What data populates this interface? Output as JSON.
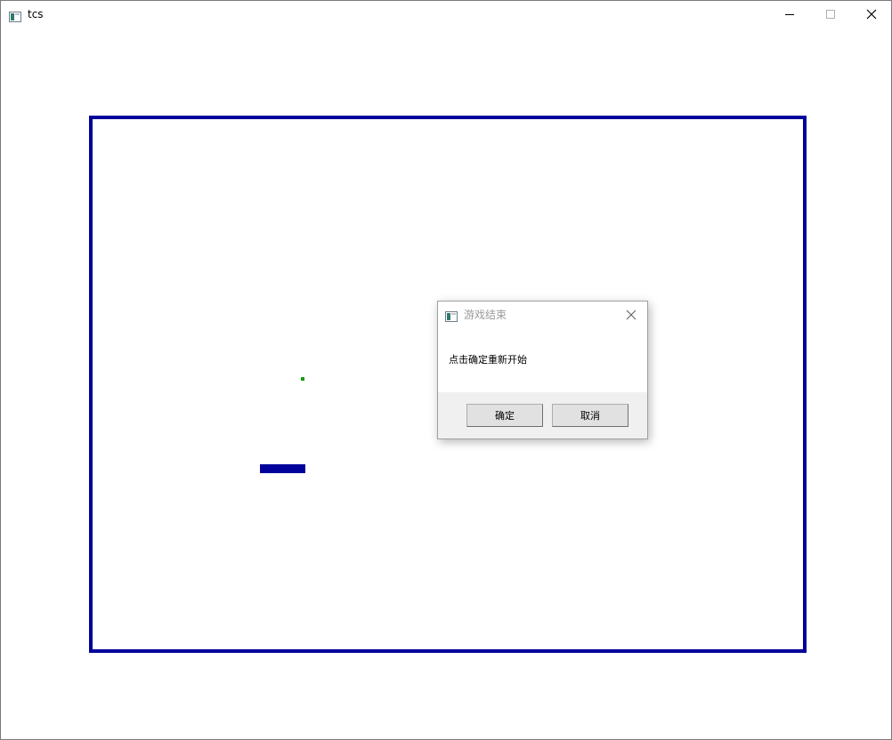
{
  "window": {
    "title": "tcs",
    "controls": [
      "minimize-icon",
      "maximize-icon",
      "close-icon"
    ]
  },
  "game": {
    "border_color": "#00009b",
    "food_color": "#169b16",
    "snake_color": "#00009b"
  },
  "dialog": {
    "title": "游戏结束",
    "message": "点击确定重新开始",
    "ok_label": "确定",
    "cancel_label": "取消"
  }
}
